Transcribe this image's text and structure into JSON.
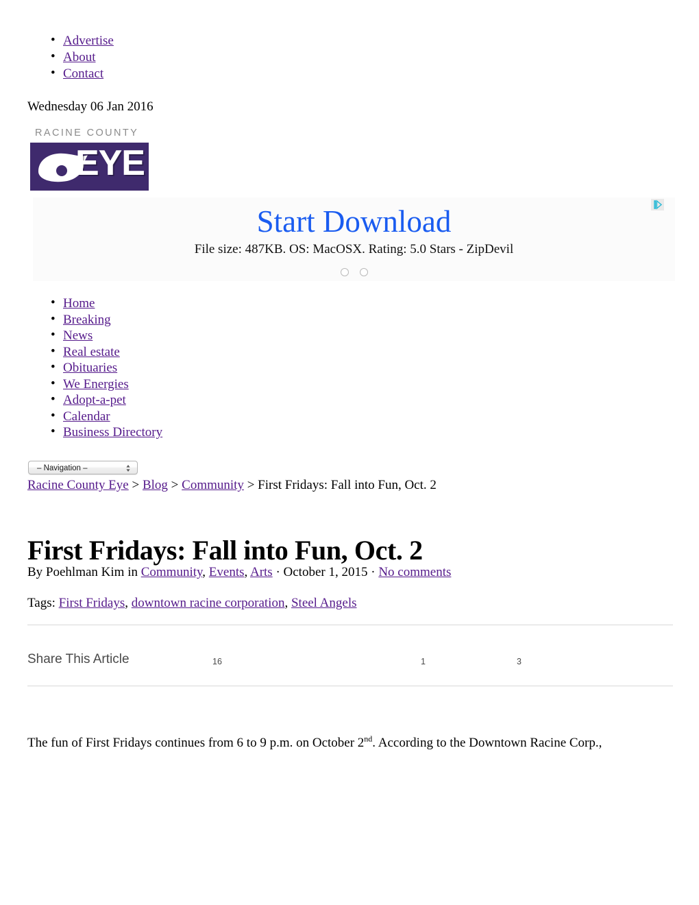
{
  "top_nav": {
    "items": [
      {
        "label": "Advertise"
      },
      {
        "label": "About"
      },
      {
        "label": "Contact"
      }
    ]
  },
  "date_line": "Wednesday 06 Jan 2016",
  "logo": {
    "wordmark": "RACINE COUNTY",
    "eye_text": "EYE",
    "purple": "#3f2a6d",
    "wordmark_gray": "#8c8c8c"
  },
  "advertisement": {
    "headline": "Start Download",
    "subtext": "File size: 487KB. OS: MacOSX. Rating: 5.0 Stars - ZipDevil",
    "headline_color": "#1a5cf0",
    "dots": 2,
    "adchoices_icon": "adchoices-triangle-icon"
  },
  "section_nav": {
    "items": [
      {
        "label": "Home"
      },
      {
        "label": "Breaking"
      },
      {
        "label": "News"
      },
      {
        "label": "Real estate"
      },
      {
        "label": "Obituaries"
      },
      {
        "label": "We Energies"
      },
      {
        "label": "Adopt-a-pet"
      },
      {
        "label": "Calendar"
      },
      {
        "label": "Business Directory"
      }
    ]
  },
  "nav_select": {
    "value": "– Navigation –"
  },
  "breadcrumb": {
    "items": [
      {
        "label": "Racine County Eye",
        "link": true
      },
      {
        "label": "Blog",
        "link": true
      },
      {
        "label": "Community",
        "link": true
      },
      {
        "label": "First Fridays: Fall into Fun, Oct. 2",
        "link": false
      }
    ],
    "separator": ">"
  },
  "article": {
    "title": "First Fridays: Fall into Fun, Oct. 2",
    "byline": {
      "by_prefix": "By Poehlman Kim in",
      "categories": [
        "Community",
        "Events",
        "Arts"
      ],
      "date": "October 1, 2015",
      "comments": "No comments",
      "dot": "·"
    },
    "tags": {
      "label": "Tags:",
      "items": [
        "First Fridays",
        "downtown racine corporation",
        "Steel Angels"
      ]
    },
    "body_part_1": "The fun of First Fridays continues from 6 to 9 p.m. on October 2",
    "body_superscript": "nd",
    "body_part_2": ".  According to the Downtown Racine Corp.,"
  },
  "share": {
    "label": "Share This Article",
    "counts": [
      "16",
      "1",
      "3"
    ]
  },
  "colors": {
    "link_purple": "#551a8b",
    "rule_gray": "#d8d8d8"
  }
}
